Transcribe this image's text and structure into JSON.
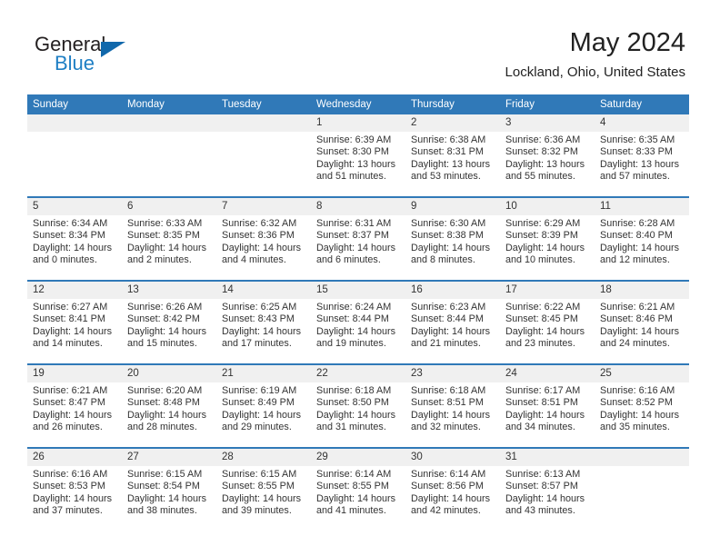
{
  "brand": {
    "name_top": "General",
    "name_bottom": "Blue",
    "triangle_color": "#1168ab",
    "blue_color": "#1f7fc4"
  },
  "header": {
    "month_title": "May 2024",
    "location": "Lockland, Ohio, United States"
  },
  "theme": {
    "header_blue": "#3079b8",
    "daynum_band": "#f0f0f0",
    "text": "#333333"
  },
  "labels": {
    "sunrise_prefix": "Sunrise:",
    "sunset_prefix": "Sunset:",
    "daylight_prefix": "Daylight:"
  },
  "columns": [
    "Sunday",
    "Monday",
    "Tuesday",
    "Wednesday",
    "Thursday",
    "Friday",
    "Saturday"
  ],
  "weeks": [
    [
      {
        "empty": true
      },
      {
        "empty": true
      },
      {
        "empty": true
      },
      {
        "day": "1",
        "sunrise": "Sunrise: 6:39 AM",
        "sunset": "Sunset: 8:30 PM",
        "daylight_line1": "Daylight: 13 hours",
        "daylight_line2": "and 51 minutes."
      },
      {
        "day": "2",
        "sunrise": "Sunrise: 6:38 AM",
        "sunset": "Sunset: 8:31 PM",
        "daylight_line1": "Daylight: 13 hours",
        "daylight_line2": "and 53 minutes."
      },
      {
        "day": "3",
        "sunrise": "Sunrise: 6:36 AM",
        "sunset": "Sunset: 8:32 PM",
        "daylight_line1": "Daylight: 13 hours",
        "daylight_line2": "and 55 minutes."
      },
      {
        "day": "4",
        "sunrise": "Sunrise: 6:35 AM",
        "sunset": "Sunset: 8:33 PM",
        "daylight_line1": "Daylight: 13 hours",
        "daylight_line2": "and 57 minutes."
      }
    ],
    [
      {
        "day": "5",
        "sunrise": "Sunrise: 6:34 AM",
        "sunset": "Sunset: 8:34 PM",
        "daylight_line1": "Daylight: 14 hours",
        "daylight_line2": "and 0 minutes."
      },
      {
        "day": "6",
        "sunrise": "Sunrise: 6:33 AM",
        "sunset": "Sunset: 8:35 PM",
        "daylight_line1": "Daylight: 14 hours",
        "daylight_line2": "and 2 minutes."
      },
      {
        "day": "7",
        "sunrise": "Sunrise: 6:32 AM",
        "sunset": "Sunset: 8:36 PM",
        "daylight_line1": "Daylight: 14 hours",
        "daylight_line2": "and 4 minutes."
      },
      {
        "day": "8",
        "sunrise": "Sunrise: 6:31 AM",
        "sunset": "Sunset: 8:37 PM",
        "daylight_line1": "Daylight: 14 hours",
        "daylight_line2": "and 6 minutes."
      },
      {
        "day": "9",
        "sunrise": "Sunrise: 6:30 AM",
        "sunset": "Sunset: 8:38 PM",
        "daylight_line1": "Daylight: 14 hours",
        "daylight_line2": "and 8 minutes."
      },
      {
        "day": "10",
        "sunrise": "Sunrise: 6:29 AM",
        "sunset": "Sunset: 8:39 PM",
        "daylight_line1": "Daylight: 14 hours",
        "daylight_line2": "and 10 minutes."
      },
      {
        "day": "11",
        "sunrise": "Sunrise: 6:28 AM",
        "sunset": "Sunset: 8:40 PM",
        "daylight_line1": "Daylight: 14 hours",
        "daylight_line2": "and 12 minutes."
      }
    ],
    [
      {
        "day": "12",
        "sunrise": "Sunrise: 6:27 AM",
        "sunset": "Sunset: 8:41 PM",
        "daylight_line1": "Daylight: 14 hours",
        "daylight_line2": "and 14 minutes."
      },
      {
        "day": "13",
        "sunrise": "Sunrise: 6:26 AM",
        "sunset": "Sunset: 8:42 PM",
        "daylight_line1": "Daylight: 14 hours",
        "daylight_line2": "and 15 minutes."
      },
      {
        "day": "14",
        "sunrise": "Sunrise: 6:25 AM",
        "sunset": "Sunset: 8:43 PM",
        "daylight_line1": "Daylight: 14 hours",
        "daylight_line2": "and 17 minutes."
      },
      {
        "day": "15",
        "sunrise": "Sunrise: 6:24 AM",
        "sunset": "Sunset: 8:44 PM",
        "daylight_line1": "Daylight: 14 hours",
        "daylight_line2": "and 19 minutes."
      },
      {
        "day": "16",
        "sunrise": "Sunrise: 6:23 AM",
        "sunset": "Sunset: 8:44 PM",
        "daylight_line1": "Daylight: 14 hours",
        "daylight_line2": "and 21 minutes."
      },
      {
        "day": "17",
        "sunrise": "Sunrise: 6:22 AM",
        "sunset": "Sunset: 8:45 PM",
        "daylight_line1": "Daylight: 14 hours",
        "daylight_line2": "and 23 minutes."
      },
      {
        "day": "18",
        "sunrise": "Sunrise: 6:21 AM",
        "sunset": "Sunset: 8:46 PM",
        "daylight_line1": "Daylight: 14 hours",
        "daylight_line2": "and 24 minutes."
      }
    ],
    [
      {
        "day": "19",
        "sunrise": "Sunrise: 6:21 AM",
        "sunset": "Sunset: 8:47 PM",
        "daylight_line1": "Daylight: 14 hours",
        "daylight_line2": "and 26 minutes."
      },
      {
        "day": "20",
        "sunrise": "Sunrise: 6:20 AM",
        "sunset": "Sunset: 8:48 PM",
        "daylight_line1": "Daylight: 14 hours",
        "daylight_line2": "and 28 minutes."
      },
      {
        "day": "21",
        "sunrise": "Sunrise: 6:19 AM",
        "sunset": "Sunset: 8:49 PM",
        "daylight_line1": "Daylight: 14 hours",
        "daylight_line2": "and 29 minutes."
      },
      {
        "day": "22",
        "sunrise": "Sunrise: 6:18 AM",
        "sunset": "Sunset: 8:50 PM",
        "daylight_line1": "Daylight: 14 hours",
        "daylight_line2": "and 31 minutes."
      },
      {
        "day": "23",
        "sunrise": "Sunrise: 6:18 AM",
        "sunset": "Sunset: 8:51 PM",
        "daylight_line1": "Daylight: 14 hours",
        "daylight_line2": "and 32 minutes."
      },
      {
        "day": "24",
        "sunrise": "Sunrise: 6:17 AM",
        "sunset": "Sunset: 8:51 PM",
        "daylight_line1": "Daylight: 14 hours",
        "daylight_line2": "and 34 minutes."
      },
      {
        "day": "25",
        "sunrise": "Sunrise: 6:16 AM",
        "sunset": "Sunset: 8:52 PM",
        "daylight_line1": "Daylight: 14 hours",
        "daylight_line2": "and 35 minutes."
      }
    ],
    [
      {
        "day": "26",
        "sunrise": "Sunrise: 6:16 AM",
        "sunset": "Sunset: 8:53 PM",
        "daylight_line1": "Daylight: 14 hours",
        "daylight_line2": "and 37 minutes."
      },
      {
        "day": "27",
        "sunrise": "Sunrise: 6:15 AM",
        "sunset": "Sunset: 8:54 PM",
        "daylight_line1": "Daylight: 14 hours",
        "daylight_line2": "and 38 minutes."
      },
      {
        "day": "28",
        "sunrise": "Sunrise: 6:15 AM",
        "sunset": "Sunset: 8:55 PM",
        "daylight_line1": "Daylight: 14 hours",
        "daylight_line2": "and 39 minutes."
      },
      {
        "day": "29",
        "sunrise": "Sunrise: 6:14 AM",
        "sunset": "Sunset: 8:55 PM",
        "daylight_line1": "Daylight: 14 hours",
        "daylight_line2": "and 41 minutes."
      },
      {
        "day": "30",
        "sunrise": "Sunrise: 6:14 AM",
        "sunset": "Sunset: 8:56 PM",
        "daylight_line1": "Daylight: 14 hours",
        "daylight_line2": "and 42 minutes."
      },
      {
        "day": "31",
        "sunrise": "Sunrise: 6:13 AM",
        "sunset": "Sunset: 8:57 PM",
        "daylight_line1": "Daylight: 14 hours",
        "daylight_line2": "and 43 minutes."
      },
      {
        "empty": true
      }
    ]
  ]
}
